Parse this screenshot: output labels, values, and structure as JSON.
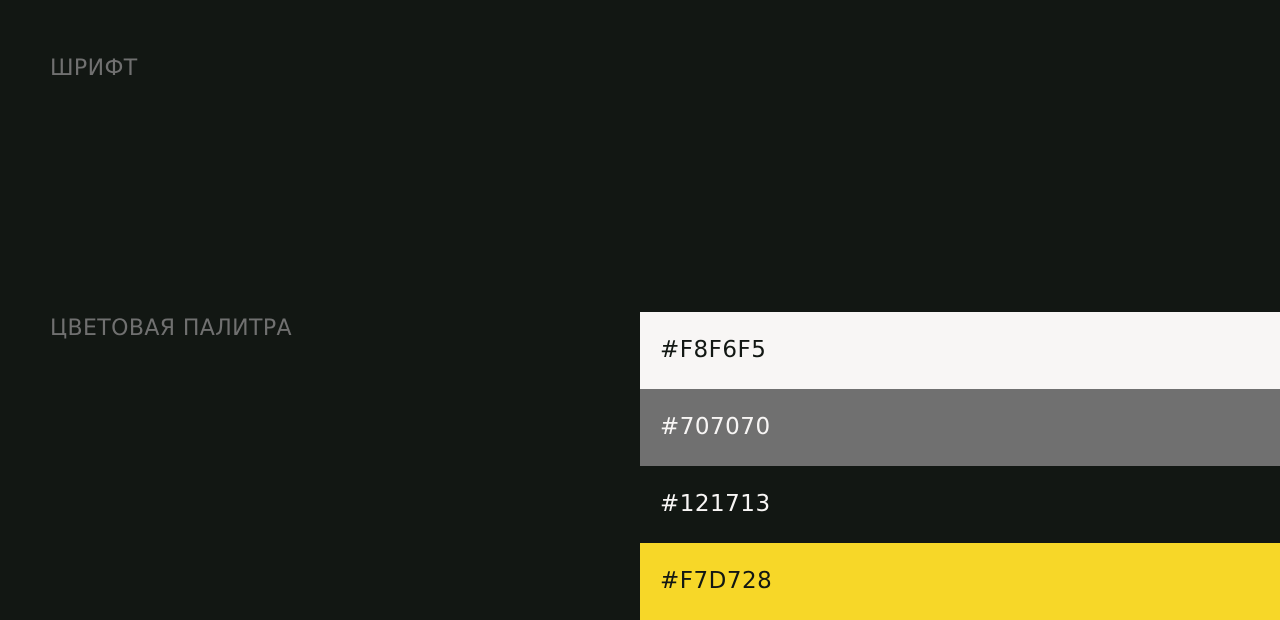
{
  "sections": {
    "font_label": "ШРИФТ",
    "palette_label": "ЦВЕТОВАЯ ПАЛИТРА"
  },
  "palette": [
    {
      "code": "#F8F6F5",
      "color": "#F8F6F5",
      "text_color": "#121713"
    },
    {
      "code": "#707070",
      "color": "#707070",
      "text_color": "#F8F6F5"
    },
    {
      "code": "#121713",
      "color": "#121713",
      "text_color": "#F8F6F5"
    },
    {
      "code": "#F7D728",
      "color": "#F7D728",
      "text_color": "#121713"
    }
  ],
  "colors": {
    "background": "#121713",
    "label": "#707070"
  }
}
